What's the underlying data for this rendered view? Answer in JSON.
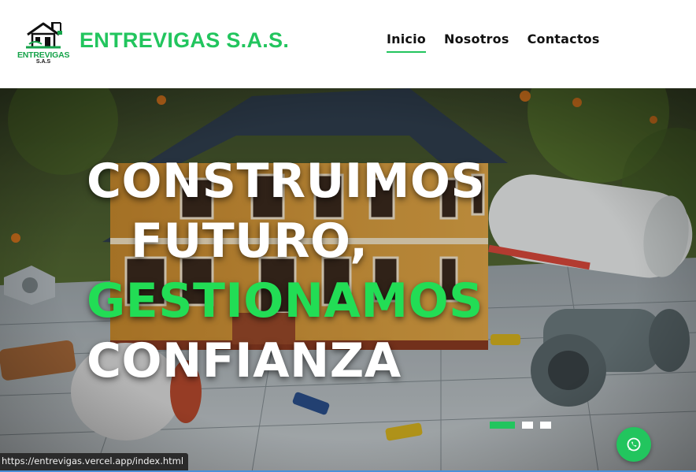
{
  "header": {
    "logo": {
      "word": "ENTREVIGAS",
      "sub": "S.A.S"
    },
    "brand": "ENTREVIGAS S.A.S.",
    "nav": [
      {
        "label": "Inicio",
        "active": true
      },
      {
        "label": "Nosotros",
        "active": false
      },
      {
        "label": "Contactos",
        "active": false
      }
    ]
  },
  "hero": {
    "line1": "CONSTRUIMOS",
    "line2": "FUTURO,",
    "line3": "GESTIONAMOS",
    "line4": "CONFIANZA",
    "slides": 3,
    "active_slide": 1,
    "image": "house-on-blueprints-illustration"
  },
  "whatsapp": {
    "icon": "whatsapp-icon"
  },
  "status_bar": {
    "url": "https://entrevigas.vercel.app/index.html"
  },
  "colors": {
    "brand_green": "#22c55e",
    "highlight_green": "#22dd55",
    "text_dark": "#111111"
  }
}
